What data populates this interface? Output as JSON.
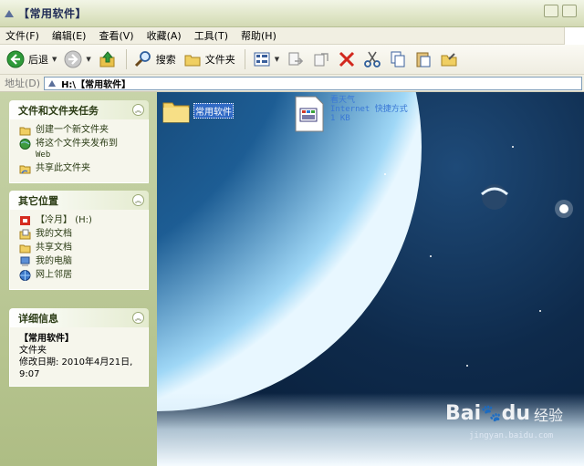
{
  "window": {
    "title": "【常用软件】"
  },
  "menu": {
    "items": [
      "文件(F)",
      "编辑(E)",
      "查看(V)",
      "收藏(A)",
      "工具(T)",
      "帮助(H)"
    ]
  },
  "toolbar": {
    "back_label": "后退",
    "search_label": "搜索",
    "folders_label": "文件夹"
  },
  "address": {
    "label": "地址(D)",
    "value": "H:\\【常用软件】"
  },
  "tasks_panel": {
    "title": "文件和文件夹任务",
    "items": [
      {
        "label": "创建一个新文件夹",
        "icon": "new-folder-icon"
      },
      {
        "label": "将这个文件夹发布到",
        "sub": "Web",
        "icon": "web-publish-icon"
      },
      {
        "label": "共享此文件夹",
        "icon": "share-folder-icon"
      }
    ]
  },
  "places_panel": {
    "title": "其它位置",
    "items": [
      {
        "label": "【冷月】 (H:)",
        "icon": "drive-icon"
      },
      {
        "label": "我的文档",
        "icon": "my-documents-icon"
      },
      {
        "label": "共享文档",
        "icon": "shared-documents-icon"
      },
      {
        "label": "我的电脑",
        "icon": "my-computer-icon"
      },
      {
        "label": "网上邻居",
        "icon": "network-icon"
      }
    ]
  },
  "details_panel": {
    "title": "详细信息",
    "name": "【常用软件】",
    "type": "文件夹",
    "modified_1": "修改日期: 2010年4月21日,",
    "modified_2": "9:07"
  },
  "files": [
    {
      "name": "常用软件",
      "icon": "folder-icon"
    },
    {
      "name": "看天气",
      "line2": "Internet 快捷方式",
      "line3": "1 KB",
      "icon": "internet-shortcut-icon"
    }
  ],
  "watermark": {
    "brand": "Bai",
    "brand2": "du",
    "jingyan": "经验",
    "sub": "jingyan.baidu.com"
  },
  "colors": {
    "selection": "#316ac5",
    "pane_bg": "#c7d3a8",
    "link_text": "#2c3d16"
  }
}
